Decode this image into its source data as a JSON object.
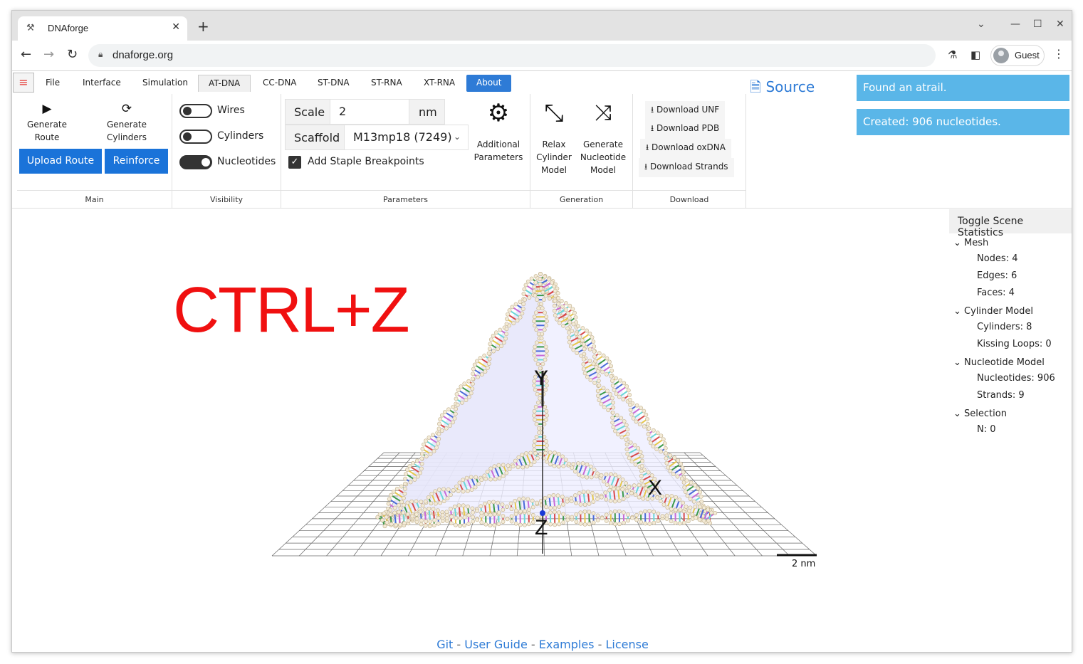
{
  "browser": {
    "tab_title": "DNAforge",
    "url": "dnaforge.org",
    "profile_name": "Guest"
  },
  "menu": {
    "tabs": [
      "File",
      "Interface",
      "Simulation",
      "AT-DNA",
      "CC-DNA",
      "ST-DNA",
      "ST-RNA",
      "XT-RNA",
      "About"
    ],
    "active": "AT-DNA"
  },
  "main_group": {
    "label": "Main",
    "generate_route": "Generate\nRoute",
    "generate_cylinders": "Generate\nCylinders",
    "upload_route": "Upload Route",
    "reinforce": "Reinforce"
  },
  "visibility_group": {
    "label": "Visibility",
    "toggles": [
      {
        "label": "Wires",
        "on": false
      },
      {
        "label": "Cylinders",
        "on": false
      },
      {
        "label": "Nucleotides",
        "on": true
      }
    ]
  },
  "parameters_group": {
    "label": "Parameters",
    "scale_label": "Scale",
    "scale_value": "2",
    "scale_unit": "nm",
    "scaffold_label": "Scaffold",
    "scaffold_value": "M13mp18 (7249)",
    "add_staple_breakpoints": "Add Staple Breakpoints",
    "additional_parameters": "Additional\nParameters"
  },
  "generation_group": {
    "label": "Generation",
    "relax": "Relax\nCylinder\nModel",
    "generate_nucleotide": "Generate\nNucleotide\nModel"
  },
  "download_group": {
    "label": "Download",
    "buttons": [
      "Download UNF",
      "Download PDB",
      "Download oxDNA",
      "Download Strands"
    ]
  },
  "source_link": "Source",
  "notifications": [
    "Found an atrail.",
    "Created: 906 nucleotides."
  ],
  "stats": {
    "toggle_label": "Toggle Scene Statistics",
    "sections": [
      {
        "name": "Mesh",
        "items": [
          "Nodes: 4",
          "Edges: 6",
          "Faces: 4"
        ]
      },
      {
        "name": "Cylinder Model",
        "items": [
          "Cylinders: 8",
          "Kissing Loops: 0"
        ]
      },
      {
        "name": "Nucleotide Model",
        "items": [
          "Nucleotides: 906",
          "Strands: 9"
        ]
      },
      {
        "name": "Selection",
        "items": [
          "N: 0"
        ]
      }
    ]
  },
  "viewport": {
    "overlay_text": "CTRL+Z",
    "axis_labels": [
      "Y",
      "X",
      "Z"
    ],
    "scale_bar": "2 nm"
  },
  "footer": {
    "links": [
      "Git",
      "User Guide",
      "Examples",
      "License"
    ],
    "separator": " - "
  }
}
